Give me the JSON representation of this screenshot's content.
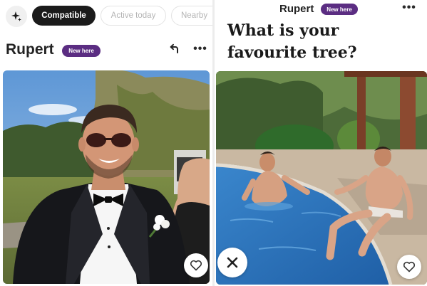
{
  "left": {
    "filters": [
      "Compatible",
      "Active today",
      "Nearby"
    ],
    "profile": {
      "name": "Rupert",
      "badge": "New here"
    },
    "icons": {
      "sparkle": "sparkle-icon",
      "undo": "undo-icon",
      "more": "more-icon",
      "like": "heart-icon"
    }
  },
  "right": {
    "profile": {
      "name": "Rupert",
      "badge": "New here"
    },
    "prompt": "What is your favourite tree?",
    "icons": {
      "more": "more-icon",
      "pass": "close-icon",
      "like": "heart-icon"
    }
  },
  "colors": {
    "badge": "#5b2d82",
    "chip_active": "#1b1b1b",
    "sky": "#6fa3d9",
    "pool": "#2d72b8"
  }
}
